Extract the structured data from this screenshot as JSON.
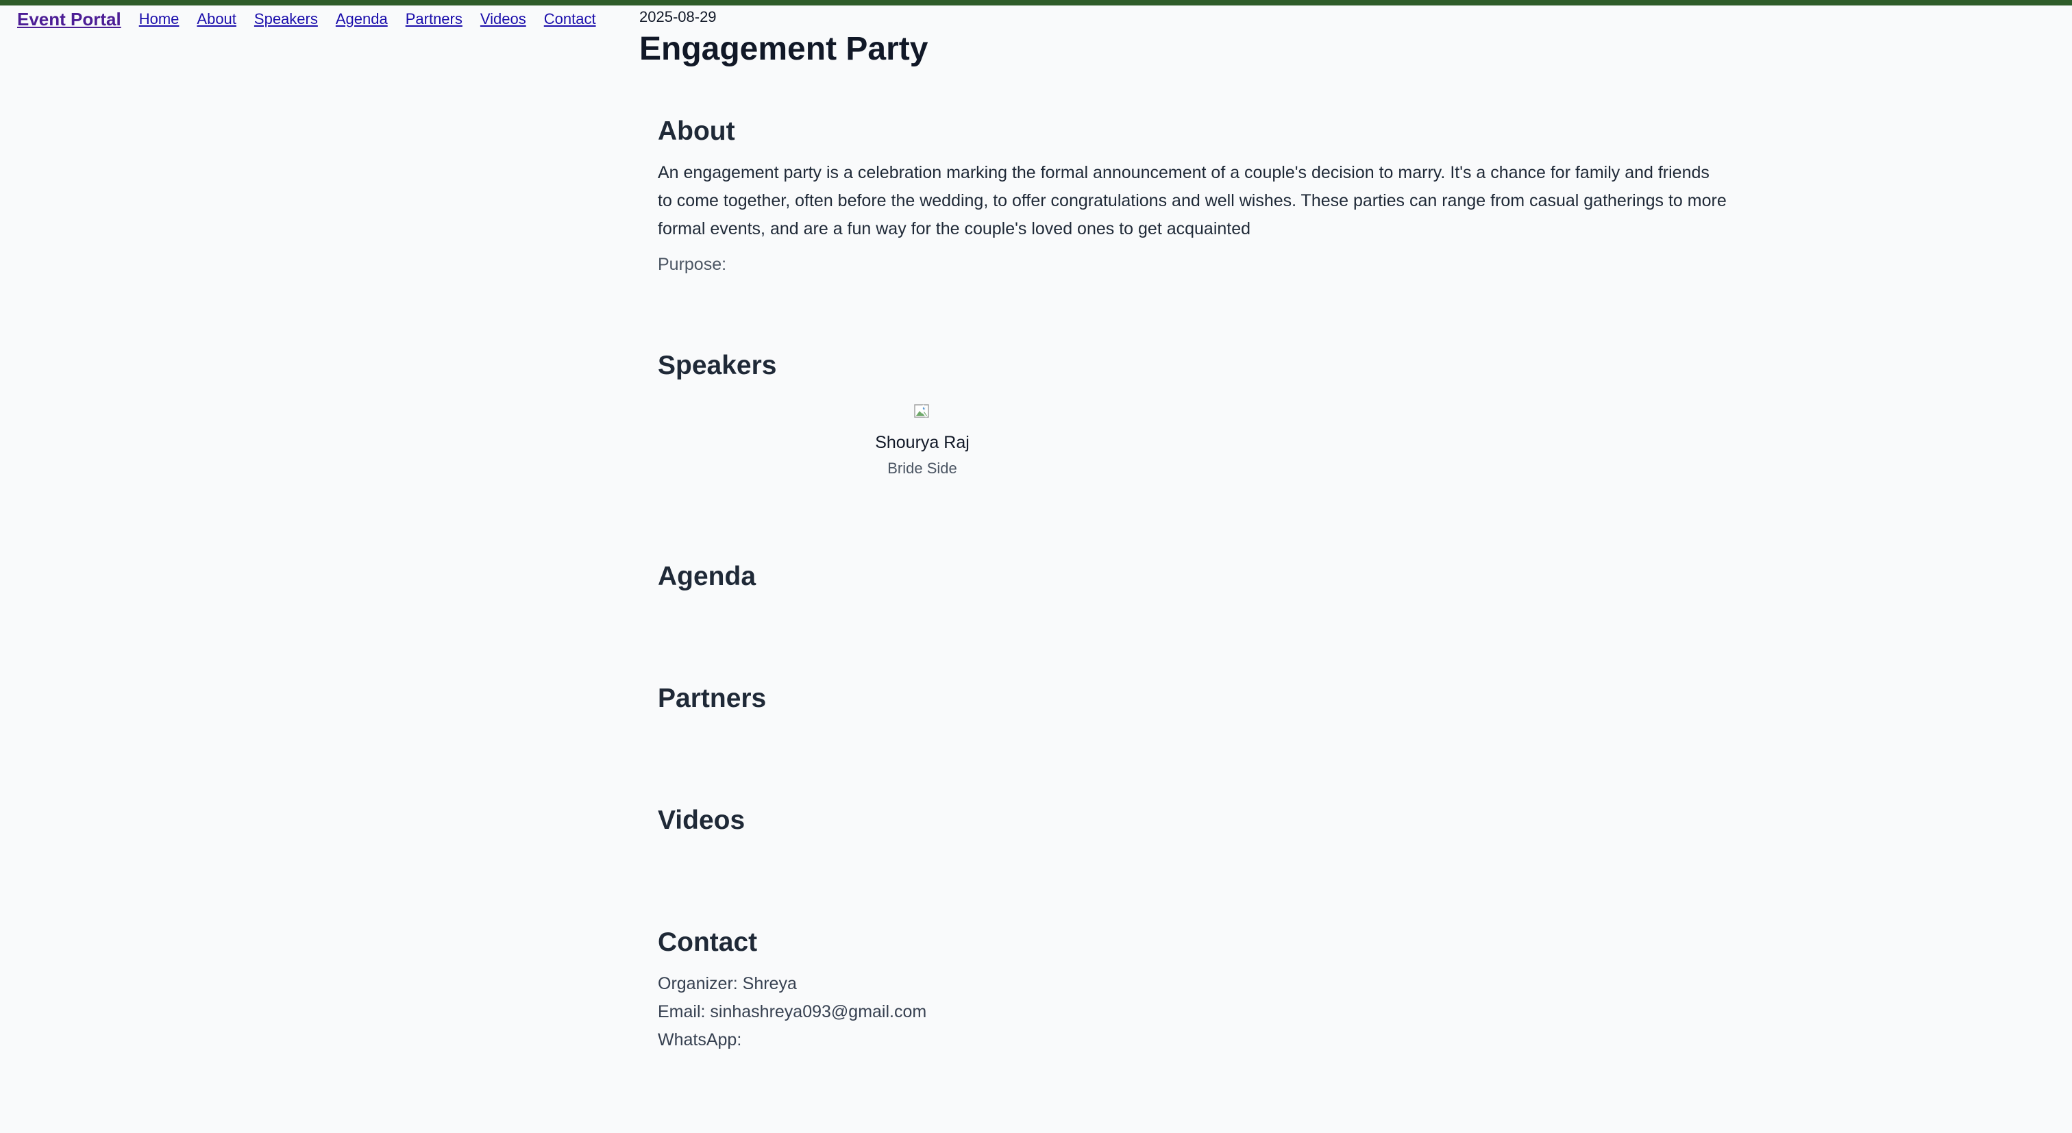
{
  "colors": {
    "top_accent": "#2f5d2a",
    "brand": "#4c1d95",
    "link": "#1a0dab",
    "background": "#f9fafb"
  },
  "nav": {
    "brand": "Event Portal",
    "links": [
      "Home",
      "About",
      "Speakers",
      "Agenda",
      "Partners",
      "Videos",
      "Contact"
    ]
  },
  "event": {
    "date": "2025-08-29",
    "title": "Engagement Party"
  },
  "about": {
    "heading": "About",
    "description": "An engagement party is a celebration marking the formal announcement of a couple's decision to marry. It's a chance for family and friends to come together, often before the wedding, to offer congratulations and well wishes. These parties can range from casual gatherings to more formal events, and are a fun way for the couple's loved ones to get acquainted",
    "purpose_label": "Purpose:"
  },
  "speakers": {
    "heading": "Speakers",
    "items": [
      {
        "name": "Shourya Raj",
        "role": "Bride Side",
        "avatar_icon": "broken-image-icon"
      }
    ]
  },
  "agenda": {
    "heading": "Agenda"
  },
  "partners": {
    "heading": "Partners"
  },
  "videos": {
    "heading": "Videos"
  },
  "contact": {
    "heading": "Contact",
    "organizer": "Organizer: Shreya",
    "email": "Email: sinhashreya093@gmail.com",
    "whatsapp": "WhatsApp:"
  }
}
